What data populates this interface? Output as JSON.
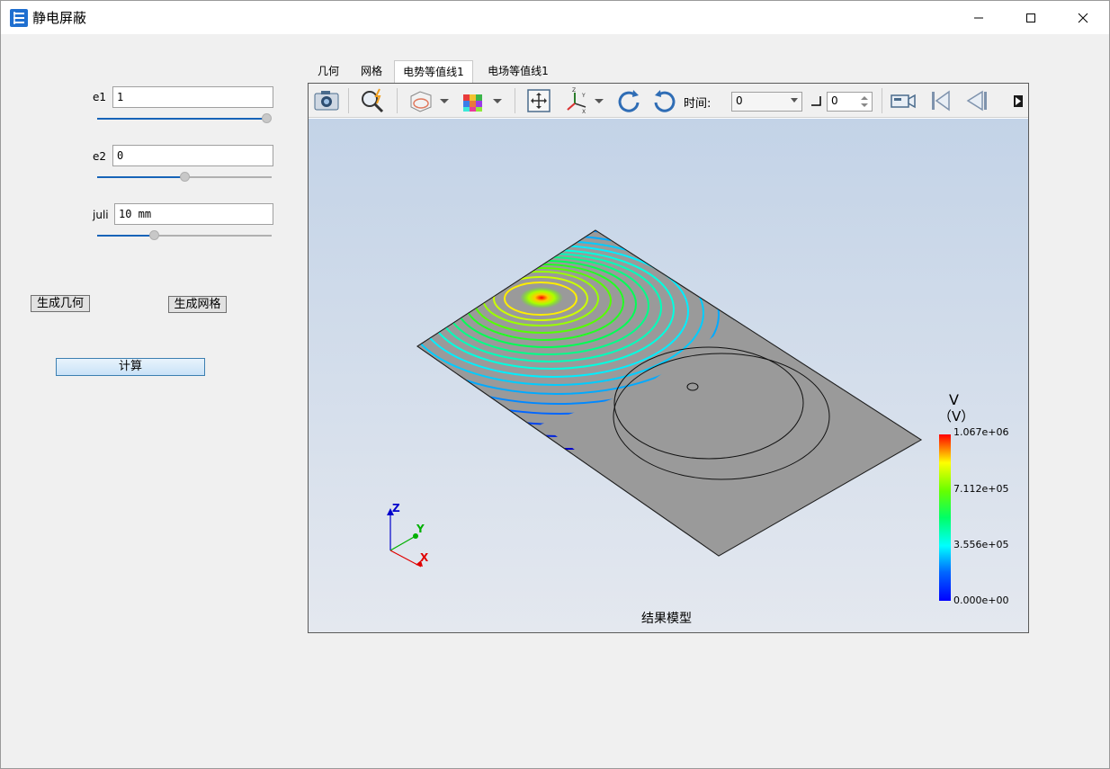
{
  "window": {
    "title": "静电屏蔽",
    "buttons": [
      "minimize",
      "maximize",
      "close"
    ]
  },
  "params": [
    {
      "label": "e1",
      "value": "1",
      "slider_fraction": 1.0
    },
    {
      "label": "e2",
      "value": "0",
      "slider_fraction": 0.5
    },
    {
      "label": "juli",
      "value": "10 mm",
      "slider_fraction": 0.33
    }
  ],
  "actions": {
    "gen_geometry": "生成几何",
    "gen_mesh": "生成网格",
    "compute": "计算"
  },
  "tabs": [
    {
      "label": "几何",
      "active": false
    },
    {
      "label": "网格",
      "active": false
    },
    {
      "label": "电势等值线1",
      "active": true
    },
    {
      "label": "电场等值线1",
      "active": false
    }
  ],
  "toolbar": {
    "icons": [
      "camera-icon",
      "zoom-icon",
      "view-cube-icon",
      "color-cube-icon",
      "fit-view-icon",
      "axes-icon",
      "rotate-cw-icon",
      "rotate-ccw-icon",
      "video-camera-icon",
      "first-frame-icon",
      "prev-frame-icon",
      "next-frame-icon"
    ],
    "time_label": "时间:",
    "time_value": "0",
    "step_value": "0"
  },
  "legend": {
    "variable": "V",
    "unit": "（V）",
    "ticks": [
      "1.067e+06",
      "7.112e+05",
      "3.556e+05",
      "0.000e+00"
    ]
  },
  "axes": {
    "x": "X",
    "y": "Y",
    "z": "Z"
  },
  "caption": "结果模型",
  "colors": {
    "accent": "#1764b8",
    "plate": "#9a9a9a",
    "background_top": "#c3d3e7",
    "background_bottom": "#e4e8ef"
  }
}
